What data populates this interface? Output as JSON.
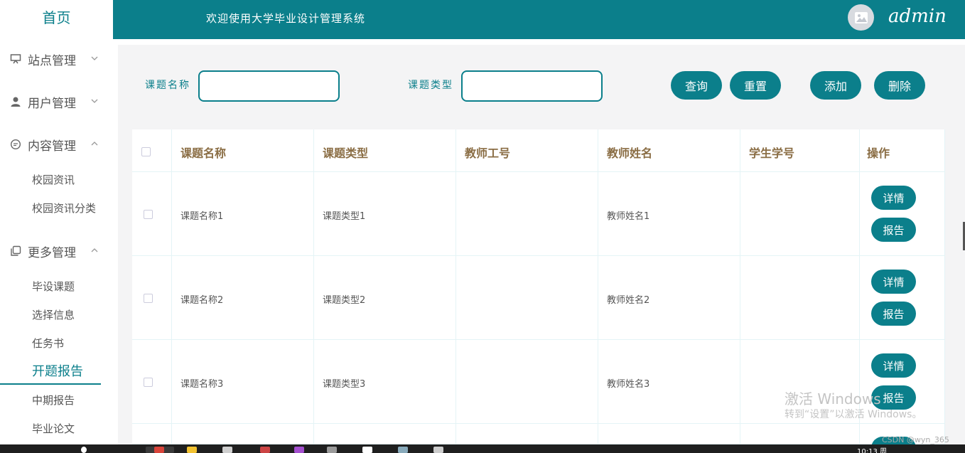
{
  "sidebar": {
    "home": "首页",
    "groups": [
      {
        "label": "站点管理",
        "icon": "display-icon"
      },
      {
        "label": "用户管理",
        "icon": "user-icon"
      },
      {
        "label": "内容管理",
        "icon": "chat-icon"
      },
      {
        "label": "更多管理",
        "icon": "copy-icon"
      }
    ],
    "content_items": [
      "校园资讯",
      "校园资讯分类"
    ],
    "more_items": [
      "毕设课题",
      "选择信息",
      "任务书",
      "开题报告",
      "中期报告",
      "毕业论文"
    ],
    "active_item": "开题报告"
  },
  "header": {
    "title": "欢迎使用大学毕业设计管理系统",
    "user": "admin"
  },
  "search": {
    "label1": "课题名称",
    "label2": "课题类型",
    "value1": "",
    "value2": "",
    "query": "查询",
    "reset": "重置",
    "add": "添加",
    "delete": "删除"
  },
  "table": {
    "headers": [
      "课题名称",
      "课题类型",
      "教师工号",
      "教师姓名",
      "学生学号",
      "操作"
    ],
    "rows": [
      {
        "name": "课题名称1",
        "type": "课题类型1",
        "teacher_no": "",
        "teacher_name": "教师姓名1",
        "student_no": ""
      },
      {
        "name": "课题名称2",
        "type": "课题类型2",
        "teacher_no": "",
        "teacher_name": "教师姓名2",
        "student_no": ""
      },
      {
        "name": "课题名称3",
        "type": "课题类型3",
        "teacher_no": "",
        "teacher_name": "教师姓名3",
        "student_no": ""
      }
    ],
    "detail_label": "详情",
    "report_label": "报告"
  },
  "watermark": {
    "line1": "激活 Windows",
    "line2": "转到“设置”以激活 Windows。",
    "csdn": "CSDN @wyn_365"
  },
  "taskbar": {
    "clock": "10:13 周"
  },
  "colors": {
    "accent": "#0b7f8b",
    "header_text": "#8a6d44"
  }
}
